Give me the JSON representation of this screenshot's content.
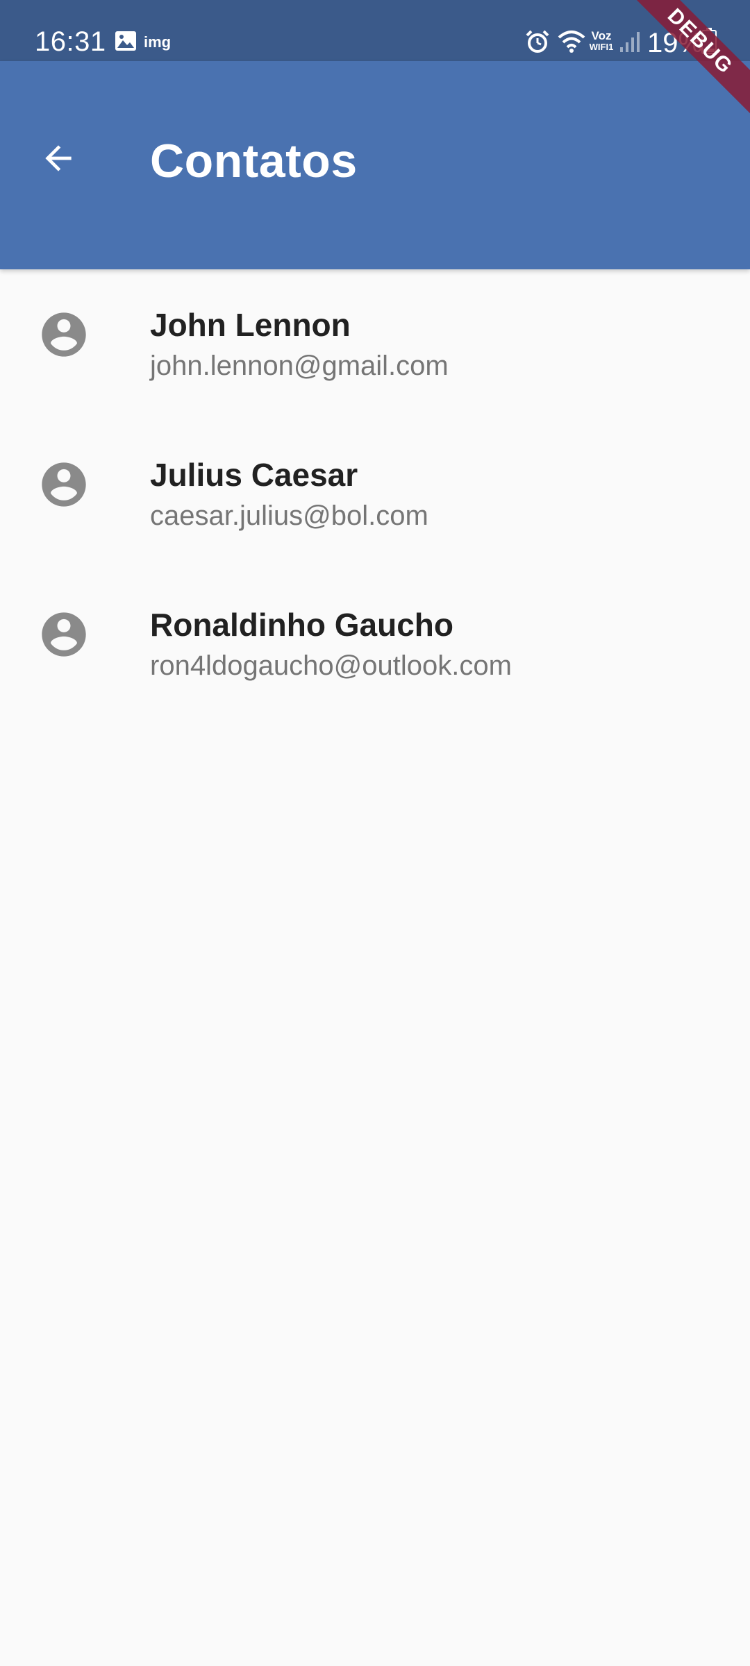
{
  "status_bar": {
    "time": "16:31",
    "notification_label": "img",
    "voz_top": "Voz",
    "voz_bottom": "WIFI1",
    "battery": "19%",
    "icons": [
      "gallery-icon",
      "alarm-icon",
      "wifi-icon",
      "signal-icon",
      "battery-icon"
    ]
  },
  "app_bar": {
    "title": "Contatos",
    "back_icon": "arrow-back-icon",
    "color": "#4a72b0"
  },
  "debug_banner": "DEBUG",
  "contacts": [
    {
      "name": "John Lennon",
      "email": "john.lennon@gmail.com",
      "icon": "account-circle-icon"
    },
    {
      "name": "Julius Caesar",
      "email": "caesar.julius@bol.com",
      "icon": "account-circle-icon"
    },
    {
      "name": "Ronaldinho Gaucho",
      "email": "ron4ldogaucho@outlook.com",
      "icon": "account-circle-icon"
    }
  ],
  "colors": {
    "status_bar": "#3b5a8a",
    "app_bar": "#4a72b0",
    "background": "#fafafa",
    "avatar": "#8a8a8a",
    "name_text": "#212121",
    "email_text": "#757575",
    "debug_banner": "#881c36"
  }
}
